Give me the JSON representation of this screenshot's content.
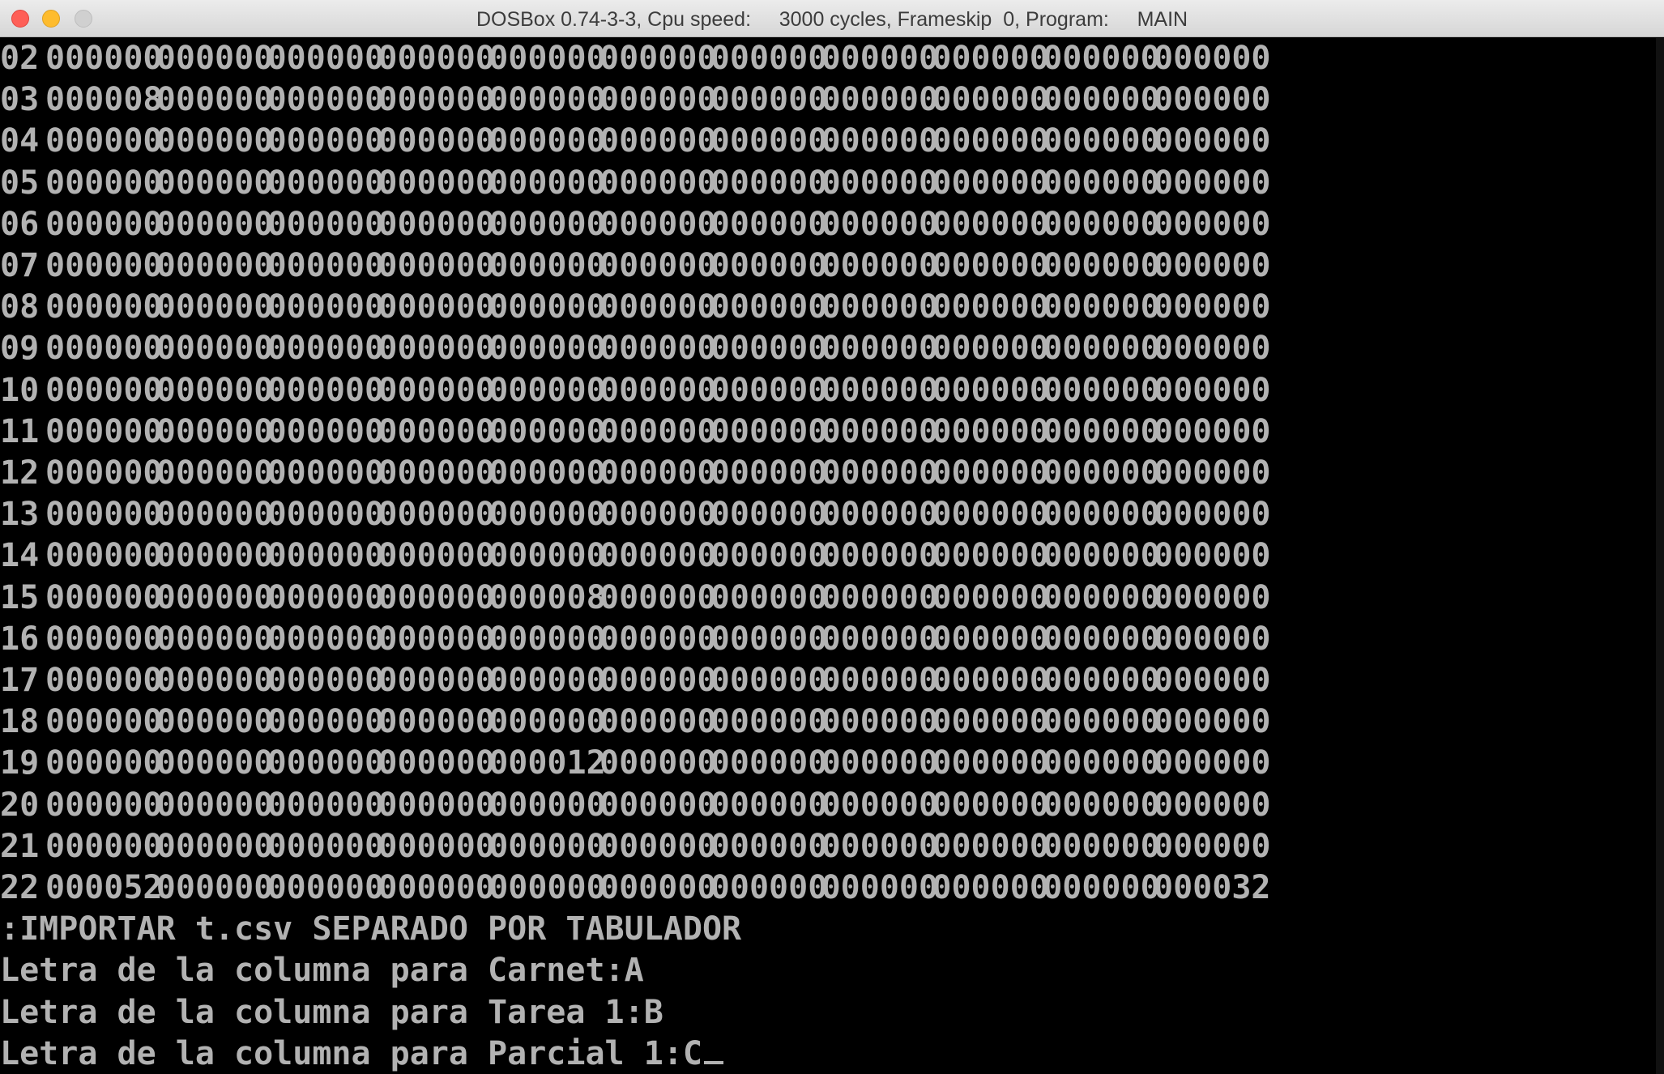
{
  "window": {
    "title": "DOSBox 0.74-3-3, Cpu speed:     3000 cycles, Frameskip  0, Program:     MAIN"
  },
  "grid_rows": [
    {
      "label": "02",
      "cells": [
        "000000",
        "000000",
        "000000",
        "000000",
        "000000",
        "000000",
        "000000",
        "000000",
        "000000",
        "000000",
        "000000"
      ]
    },
    {
      "label": "03",
      "cells": [
        "000008",
        "000000",
        "000000",
        "000000",
        "000000",
        "000000",
        "000000",
        "000000",
        "000000",
        "000000",
        "000000"
      ]
    },
    {
      "label": "04",
      "cells": [
        "000000",
        "000000",
        "000000",
        "000000",
        "000000",
        "000000",
        "000000",
        "000000",
        "000000",
        "000000",
        "000000"
      ]
    },
    {
      "label": "05",
      "cells": [
        "000000",
        "000000",
        "000000",
        "000000",
        "000000",
        "000000",
        "000000",
        "000000",
        "000000",
        "000000",
        "000000"
      ]
    },
    {
      "label": "06",
      "cells": [
        "000000",
        "000000",
        "000000",
        "000000",
        "000000",
        "000000",
        "000000",
        "000000",
        "000000",
        "000000",
        "000000"
      ]
    },
    {
      "label": "07",
      "cells": [
        "000000",
        "000000",
        "000000",
        "000000",
        "000000",
        "000000",
        "000000",
        "000000",
        "000000",
        "000000",
        "000000"
      ]
    },
    {
      "label": "08",
      "cells": [
        "000000",
        "000000",
        "000000",
        "000000",
        "000000",
        "000000",
        "000000",
        "000000",
        "000000",
        "000000",
        "000000"
      ]
    },
    {
      "label": "09",
      "cells": [
        "000000",
        "000000",
        "000000",
        "000000",
        "000000",
        "000000",
        "000000",
        "000000",
        "000000",
        "000000",
        "000000"
      ]
    },
    {
      "label": "10",
      "cells": [
        "000000",
        "000000",
        "000000",
        "000000",
        "000000",
        "000000",
        "000000",
        "000000",
        "000000",
        "000000",
        "000000"
      ]
    },
    {
      "label": "11",
      "cells": [
        "000000",
        "000000",
        "000000",
        "000000",
        "000000",
        "000000",
        "000000",
        "000000",
        "000000",
        "000000",
        "000000"
      ]
    },
    {
      "label": "12",
      "cells": [
        "000000",
        "000000",
        "000000",
        "000000",
        "000000",
        "000000",
        "000000",
        "000000",
        "000000",
        "000000",
        "000000"
      ]
    },
    {
      "label": "13",
      "cells": [
        "000000",
        "000000",
        "000000",
        "000000",
        "000000",
        "000000",
        "000000",
        "000000",
        "000000",
        "000000",
        "000000"
      ]
    },
    {
      "label": "14",
      "cells": [
        "000000",
        "000000",
        "000000",
        "000000",
        "000000",
        "000000",
        "000000",
        "000000",
        "000000",
        "000000",
        "000000"
      ]
    },
    {
      "label": "15",
      "cells": [
        "000000",
        "000000",
        "000000",
        "000000",
        "000008",
        "000000",
        "000000",
        "000000",
        "000000",
        "000000",
        "000000"
      ]
    },
    {
      "label": "16",
      "cells": [
        "000000",
        "000000",
        "000000",
        "000000",
        "000000",
        "000000",
        "000000",
        "000000",
        "000000",
        "000000",
        "000000"
      ]
    },
    {
      "label": "17",
      "cells": [
        "000000",
        "000000",
        "000000",
        "000000",
        "000000",
        "000000",
        "000000",
        "000000",
        "000000",
        "000000",
        "000000"
      ]
    },
    {
      "label": "18",
      "cells": [
        "000000",
        "000000",
        "000000",
        "000000",
        "000000",
        "000000",
        "000000",
        "000000",
        "000000",
        "000000",
        "000000"
      ]
    },
    {
      "label": "19",
      "cells": [
        "000000",
        "000000",
        "000000",
        "000000",
        "000012",
        "000000",
        "000000",
        "000000",
        "000000",
        "000000",
        "000000"
      ]
    },
    {
      "label": "20",
      "cells": [
        "000000",
        "000000",
        "000000",
        "000000",
        "000000",
        "000000",
        "000000",
        "000000",
        "000000",
        "000000",
        "000000"
      ]
    },
    {
      "label": "21",
      "cells": [
        "000000",
        "000000",
        "000000",
        "000000",
        "000000",
        "000000",
        "000000",
        "000000",
        "000000",
        "000000",
        "000000"
      ]
    },
    {
      "label": "22",
      "cells": [
        "000052",
        "000000",
        "000000",
        "000000",
        "000000",
        "000000",
        "000000",
        "000000",
        "000000",
        "000000",
        "000032"
      ]
    }
  ],
  "console": {
    "lines": [
      ":IMPORTAR t.csv SEPARADO POR TABULADOR",
      "Letra de la columna para Carnet:A",
      "Letra de la columna para Tarea 1:B"
    ],
    "prompt_line": "Letra de la columna para Parcial 1:C"
  }
}
